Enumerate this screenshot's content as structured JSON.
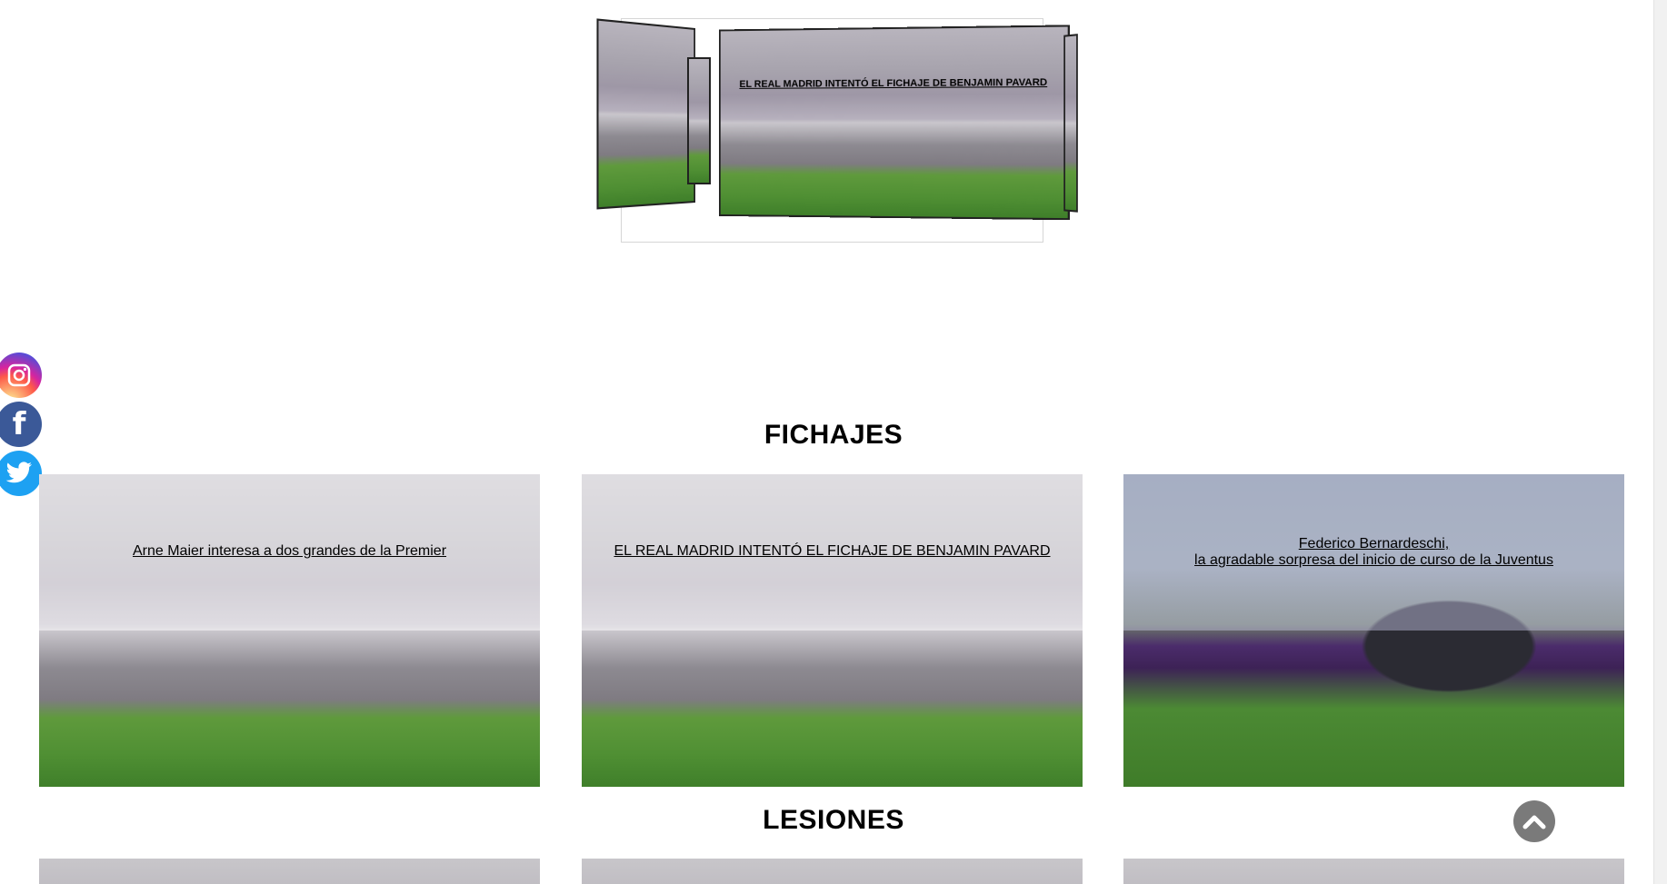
{
  "carousel": {
    "slides": [
      {
        "id": "left",
        "title": ""
      },
      {
        "id": "left2",
        "title": ""
      },
      {
        "id": "center",
        "title": "EL REAL MADRID INTENTÓ EL FICHAJE DE BENJAMIN PAVARD"
      },
      {
        "id": "right",
        "title": ""
      }
    ]
  },
  "social": {
    "instagram_icon": "instagram-icon",
    "facebook_icon": "facebook-icon",
    "twitter_icon": "twitter-icon",
    "facebook_glyph": "f"
  },
  "sections": {
    "fichajes": {
      "title": "FICHAJES",
      "cards": [
        {
          "caption": "Arne Maier interesa a dos grandes de la Premier"
        },
        {
          "caption": "EL REAL MADRID INTENTÓ EL FICHAJE DE BENJAMIN PAVARD"
        },
        {
          "caption_line1": "Federico Bernardeschi,",
          "caption_line2": "la agradable sorpresa del inicio de curso de la Juventus"
        }
      ]
    },
    "lesiones": {
      "title": "LESIONES"
    }
  },
  "back_to_top_icon": "chevron-up-icon",
  "colors": {
    "instagram": "#d6249f",
    "facebook": "#3b5998",
    "twitter": "#1da1f2",
    "back_to_top": "#7a7a7a"
  }
}
